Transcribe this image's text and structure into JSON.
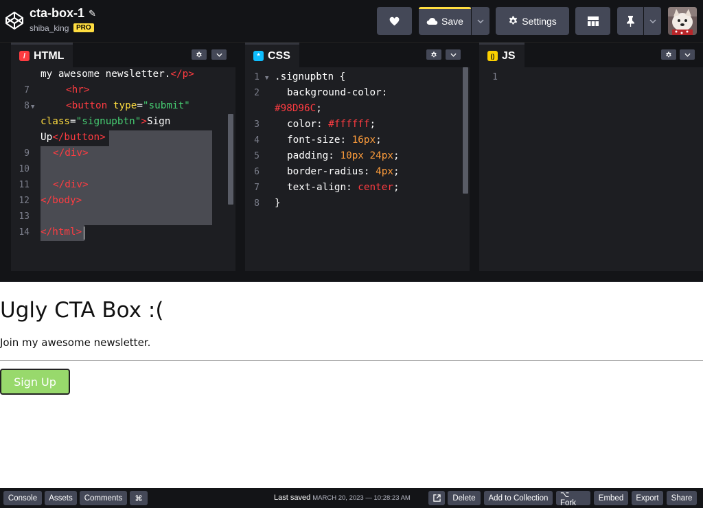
{
  "header": {
    "title": "cta-box-1",
    "username": "shiba_king",
    "badge": "PRO",
    "save_label": "Save",
    "settings_label": "Settings"
  },
  "panels": {
    "html": {
      "label": "HTML",
      "icon": "html-icon"
    },
    "css": {
      "label": "CSS",
      "icon": "css-icon"
    },
    "js": {
      "label": "JS",
      "icon": "js-icon"
    }
  },
  "html_code": {
    "line_numbers": [
      "7",
      "8",
      "9",
      "10",
      "11",
      "12",
      "13",
      "14"
    ],
    "l0": "my awesome newsletter.",
    "l0_close": "</p>",
    "l7": "<hr>",
    "l8_open": "<button",
    "l8_type_attr": " type",
    "l8_type_eq": "=",
    "l8_type_val": "\"submit\"",
    "l8b_class": "class",
    "l8b_eq": "=",
    "l8b_val": "\"signupbtn\"",
    "l8b_gt": ">",
    "l8b_text": "Sign",
    "l8c_text": "Up",
    "l8c_close": "</button>",
    "l8c_gt": ">",
    "l9": "</div>",
    "l11": "</div>",
    "l12": "</body>",
    "l14": "</html>"
  },
  "css_code": {
    "line_numbers": [
      "1",
      "2",
      "3",
      "4",
      "5",
      "6",
      "7",
      "8"
    ],
    "selector": ".signupbtn {",
    "bg_prop": "background-color:",
    "bg_val": "#98D96C",
    "semi": ";",
    "color_prop": "color:",
    "color_val": "#ffffff",
    "fs_prop": "font-size:",
    "fs_val": "16px",
    "pad_prop": "padding:",
    "pad_val": "10px 24px",
    "br_prop": "border-radius:",
    "br_val": "4px",
    "ta_prop": "text-align:",
    "ta_val": "center",
    "close": "}"
  },
  "js_code": {
    "line_numbers": [
      "1"
    ]
  },
  "preview": {
    "heading": "Ugly CTA Box :(",
    "paragraph": "Join my awesome newsletter.",
    "button": "Sign Up",
    "button_color": "#98D96C"
  },
  "footer": {
    "console": "Console",
    "assets": "Assets",
    "comments": "Comments",
    "shortcut": "⌘",
    "last_saved_label": "Last saved",
    "last_saved_date": "MARCH 20, 2023 — 10:28:23 AM",
    "delete": "Delete",
    "add_to_collection": "Add to Collection",
    "fork": "⌥ Fork",
    "embed": "Embed",
    "export": "Export",
    "share": "Share"
  },
  "colors": {
    "accent_yellow": "#ffdd40",
    "tag_red": "#ff3c41",
    "string_green": "#47cf73",
    "number_orange": "#ff9d3b"
  }
}
